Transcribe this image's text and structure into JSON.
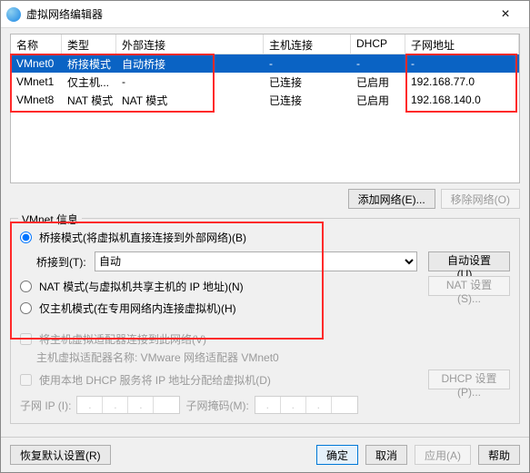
{
  "title": "虚拟网络编辑器",
  "columns": {
    "name": "名称",
    "type": "类型",
    "ext": "外部连接",
    "host": "主机连接",
    "dhcp": "DHCP",
    "subnet": "子网地址"
  },
  "rows": [
    {
      "name": "VMnet0",
      "type": "桥接模式",
      "ext": "自动桥接",
      "host": "-",
      "dhcp": "-",
      "subnet": "-"
    },
    {
      "name": "VMnet1",
      "type": "仅主机...",
      "ext": "-",
      "host": "已连接",
      "dhcp": "已启用",
      "subnet": "192.168.77.0"
    },
    {
      "name": "VMnet8",
      "type": "NAT 模式",
      "ext": "NAT 模式",
      "host": "已连接",
      "dhcp": "已启用",
      "subnet": "192.168.140.0"
    }
  ],
  "buttons": {
    "add_network": "添加网络(E)...",
    "remove_network": "移除网络(O)",
    "auto_set": "自动设置(U)...",
    "nat_set": "NAT 设置(S)...",
    "dhcp_set": "DHCP 设置(P)...",
    "restore": "恢复默认设置(R)",
    "ok": "确定",
    "cancel": "取消",
    "apply": "应用(A)",
    "help": "帮助"
  },
  "group": {
    "legend": "VMnet 信息",
    "radio_bridge": "桥接模式(将虚拟机直接连接到外部网络)(B)",
    "bridge_to_label": "桥接到(T):",
    "bridge_to_value": "自动",
    "radio_nat": "NAT 模式(与虚拟机共享主机的 IP 地址)(N)",
    "radio_hostonly": "仅主机模式(在专用网络内连接虚拟机)(H)",
    "chk_host_adapter": "将主机虚拟适配器连接到此网络(V)",
    "host_adapter_name": "主机虚拟适配器名称: VMware 网络适配器 VMnet0",
    "chk_dhcp": "使用本地 DHCP 服务将 IP 地址分配给虚拟机(D)",
    "subnet_ip_label": "子网 IP (I):",
    "subnet_mask_label": "子网掩码(M):"
  }
}
